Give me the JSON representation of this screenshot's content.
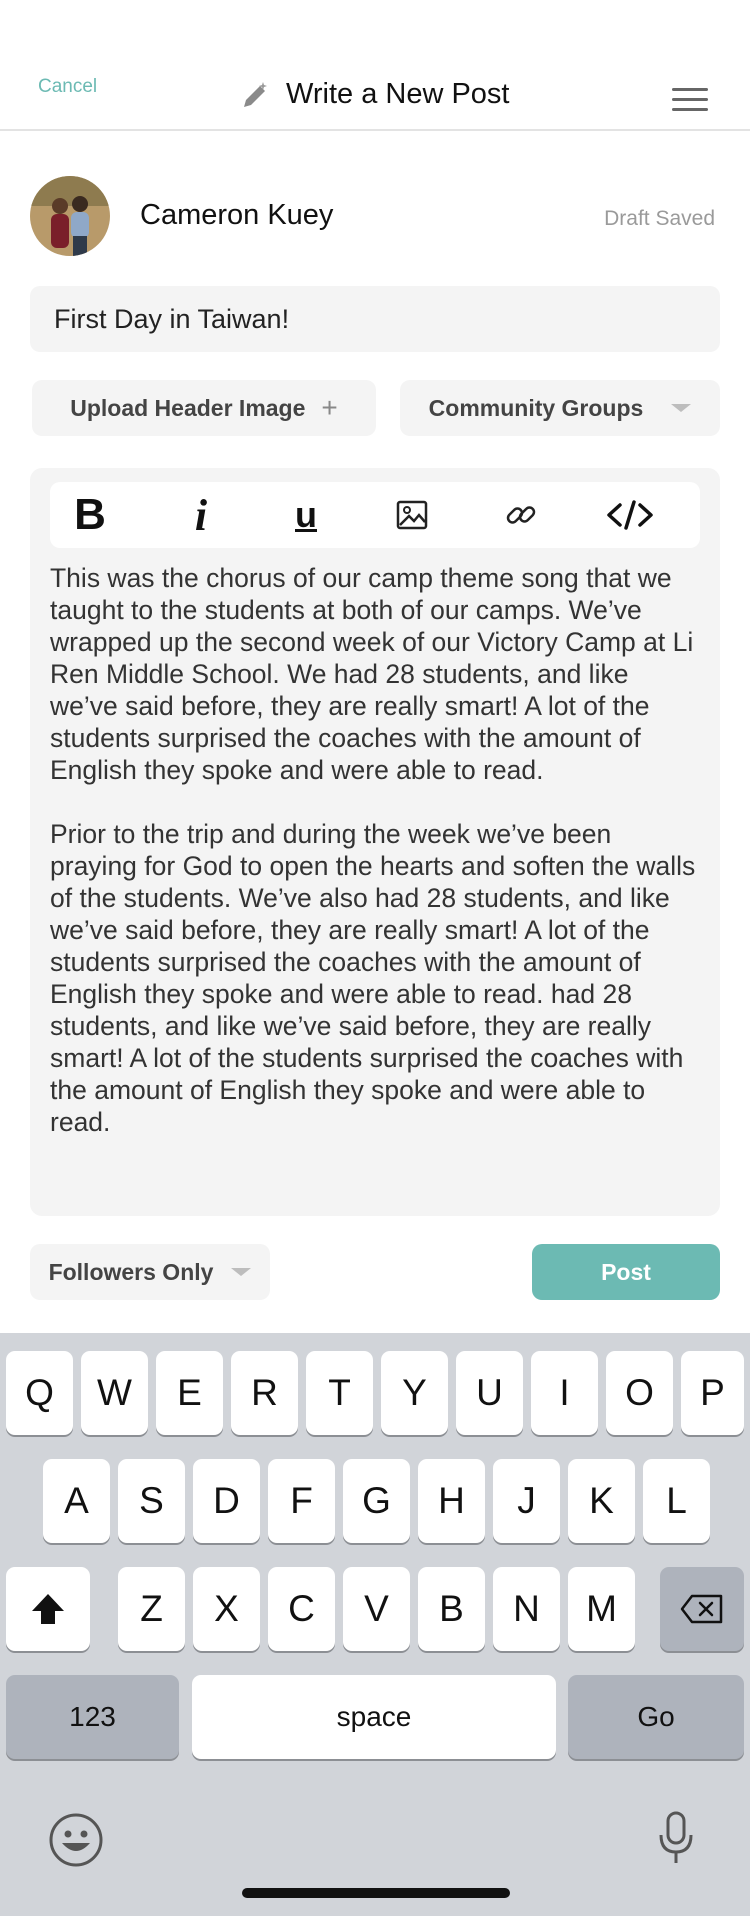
{
  "header": {
    "cancel_label": "Cancel",
    "title": "Write a New Post"
  },
  "author": {
    "name": "Cameron Kuey",
    "draft_status": "Draft Saved"
  },
  "post": {
    "title_value": "First Day in Taiwan!",
    "paragraphs": [
      "This was the chorus of our camp theme song that we taught to the students at both of our camps. We’ve wrapped up the second week of our Victory Camp at Li Ren Middle School. We had 28 students, and like we’ve said before, they are really smart! A lot of the students surprised the coaches with the amount of English they spoke and were able to read.",
      "Prior to the trip and during the week we’ve been praying for God to open the hearts and soften the walls of the students. We’ve also had 28 students, and like we’ve said before, they are really smart! A lot of the students surprised the coaches with the amount of English they spoke and were able to read. had 28 students, and like we’ve said before, they are really smart! A lot of the students surprised the coaches with the amount of English they spoke and were able to read."
    ]
  },
  "actions": {
    "upload_header_label": "Upload Header Image",
    "upload_plus": "+",
    "community_groups_label": "Community Groups",
    "visibility_label": "Followers Only",
    "post_label": "Post"
  },
  "toolbar": {
    "bold": "B",
    "italic": "i",
    "underline": "u"
  },
  "keyboard": {
    "row1": [
      "Q",
      "W",
      "E",
      "R",
      "T",
      "Y",
      "U",
      "I",
      "O",
      "P"
    ],
    "row2": [
      "A",
      "S",
      "D",
      "F",
      "G",
      "H",
      "J",
      "K",
      "L"
    ],
    "row3": [
      "Z",
      "X",
      "C",
      "V",
      "B",
      "N",
      "M"
    ],
    "numbers_label": "123",
    "space_label": "space",
    "go_label": "Go"
  },
  "colors": {
    "accent": "#6cbab3",
    "keyboard_bg": "#d1d4d9"
  }
}
